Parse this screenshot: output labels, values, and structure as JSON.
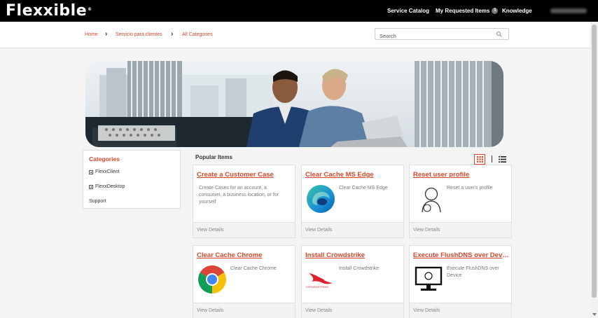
{
  "brand": {
    "logo": "Flexxible",
    "mark": "®"
  },
  "header": {
    "nav": [
      {
        "label": "Service Catalog"
      },
      {
        "label": "My Requested Items",
        "badge": "1"
      },
      {
        "label": "Knowledge"
      }
    ]
  },
  "breadcrumb": [
    "Home",
    "Servicio para clientes",
    "All Categories"
  ],
  "search": {
    "placeholder": "Search",
    "value": ""
  },
  "categories": {
    "title": "Categories",
    "items": [
      {
        "label": "FlexxClient",
        "expandable": true
      },
      {
        "label": "FlexxDesktop",
        "expandable": true
      },
      {
        "label": "Support",
        "expandable": false
      }
    ]
  },
  "popular": {
    "title": "Popular Items",
    "view_mode": "grid",
    "cards": [
      {
        "title": "Create a Customer Case",
        "desc": "Create Cases for an account, a consumer, a business location, or for yourself",
        "icon": "none",
        "footer": "View Details"
      },
      {
        "title": "Clear Cache MS Edge",
        "desc": "Clear Cache MS Edge",
        "icon": "edge-icon",
        "footer": "View Details"
      },
      {
        "title": "Reset user profile",
        "desc": "Reset a user's profile",
        "icon": "user-icon",
        "footer": "View Details"
      },
      {
        "title": "Clear Cache Chrome",
        "desc": "Clear Cache Chrome",
        "icon": "chrome-icon",
        "footer": "View Details"
      },
      {
        "title": "Install Crowdstrike",
        "desc": "Install Crowdstrike",
        "icon": "crowdstrike-icon",
        "footer": "View Details",
        "icon_text": "CROWDSTRIKE"
      },
      {
        "title": "Execute FlushDNS over Device",
        "desc": "Execute FlushDNS over Device",
        "icon": "monitor-icon",
        "footer": "View Details"
      }
    ]
  },
  "colors": {
    "accent": "#d8472a",
    "topbar": "#000000",
    "background": "#f4f4f4"
  }
}
